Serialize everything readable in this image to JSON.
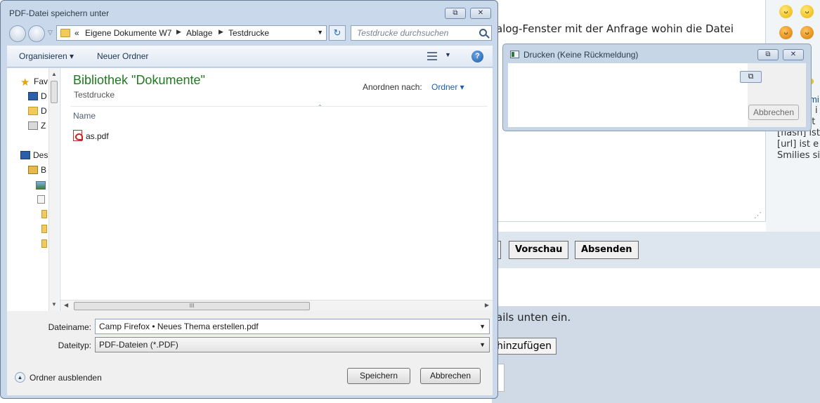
{
  "background_page": {
    "editor_text": "alog-Fenster mit der Anfrage wohin die Datei",
    "help_lines": [
      "i",
      "[img] ist",
      "[flash] ist",
      "[url] ist e",
      "Smilies sin"
    ],
    "sidebar_link": "mi",
    "buttons": {
      "preview": "Vorschau",
      "submit": "Absenden"
    },
    "section_text": "ails unten ein.",
    "add_button": "hinzufügen"
  },
  "print_window": {
    "title": "Drucken (Keine Rückmeldung)",
    "restore_glyph": "⧉",
    "cancel_label": "Abbrechen"
  },
  "save_dialog": {
    "title": "PDF-Datei speichern unter",
    "caption": {
      "restore_glyph": "⧉",
      "close_glyph": "✕"
    },
    "address": {
      "overflow": "«",
      "crumbs": [
        "Eigene Dokumente W7",
        "Ablage",
        "Testdrucke"
      ]
    },
    "search_placeholder": "Testdrucke durchsuchen",
    "toolbar": {
      "organize": "Organisieren ▾",
      "new_folder": "Neuer Ordner",
      "help": "?"
    },
    "nav_pane": {
      "items": [
        {
          "label": "Fav",
          "icon": "star-icon"
        },
        {
          "label": "D",
          "icon": "monitor-icon"
        },
        {
          "label": "D",
          "icon": "folder-icon"
        },
        {
          "label": "Z",
          "icon": "place-icon"
        },
        {
          "label": "Des",
          "icon": "monitor-icon"
        },
        {
          "label": "B",
          "icon": "lib-icon"
        },
        {
          "label": "",
          "icon": "img-icon"
        },
        {
          "label": "",
          "icon": "doc-icon"
        },
        {
          "label": "",
          "icon": "folder-icon"
        },
        {
          "label": "",
          "icon": "folder-icon"
        },
        {
          "label": "",
          "icon": "folder-icon"
        }
      ]
    },
    "library": {
      "title": "Bibliothek \"Dokumente\"",
      "subtitle": "Testdrucke",
      "arrange_label": "Anordnen nach:",
      "arrange_value": "Ordner ▾"
    },
    "columns": {
      "name": "Name"
    },
    "files": [
      {
        "name": "as.pdf",
        "icon": "pdf-icon"
      }
    ],
    "hscroll_grip": "III",
    "form": {
      "filename_label": "Dateiname:",
      "filename_value": "Camp Firefox • Neues Thema erstellen.pdf",
      "filetype_label": "Dateityp:",
      "filetype_value": "PDF-Dateien (*.PDF)"
    },
    "hide_folders_label": "Ordner ausblenden",
    "save_label": "Speichern",
    "cancel_label": "Abbrechen"
  },
  "colors": {
    "dialog_frame": "#c9d8ea",
    "library_title": "#1e7a1e",
    "link_blue": "#1e5fa8"
  }
}
